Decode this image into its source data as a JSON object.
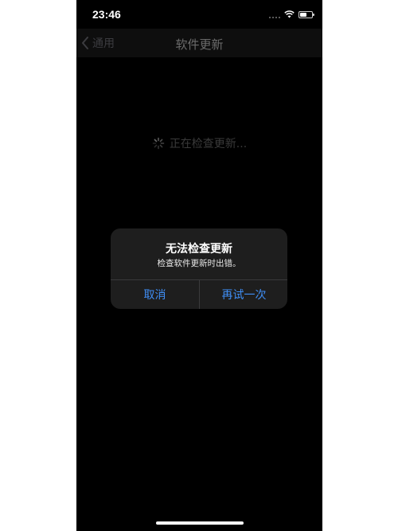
{
  "status_bar": {
    "time": "23:46",
    "battery_level": 0.6
  },
  "nav": {
    "back_label": "通用",
    "title": "软件更新"
  },
  "main": {
    "checking_text": "正在检查更新..."
  },
  "alert": {
    "title": "无法检查更新",
    "message": "检查软件更新时出错。",
    "cancel_label": "取消",
    "retry_label": "再试一次"
  },
  "colors": {
    "accent": "#3f8ef5",
    "background": "#000000",
    "alert_background": "#1e1e1e"
  }
}
